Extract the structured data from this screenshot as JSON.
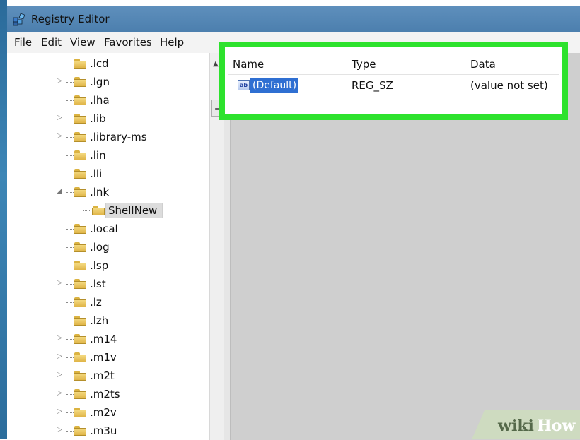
{
  "window": {
    "title": "Registry Editor"
  },
  "menu": [
    "File",
    "Edit",
    "View",
    "Favorites",
    "Help"
  ],
  "tree": {
    "items": [
      {
        "label": ".lcd",
        "expander": ""
      },
      {
        "label": ".lgn",
        "expander": "▷"
      },
      {
        "label": ".lha",
        "expander": ""
      },
      {
        "label": ".lib",
        "expander": "▷"
      },
      {
        "label": ".library-ms",
        "expander": "▷"
      },
      {
        "label": ".lin",
        "expander": ""
      },
      {
        "label": ".lli",
        "expander": ""
      },
      {
        "label": ".lnk",
        "expander": "◢"
      },
      {
        "label": "ShellNew",
        "expander": "",
        "child": true,
        "selected": true
      },
      {
        "label": ".local",
        "expander": ""
      },
      {
        "label": ".log",
        "expander": ""
      },
      {
        "label": ".lsp",
        "expander": ""
      },
      {
        "label": ".lst",
        "expander": "▷"
      },
      {
        "label": ".lz",
        "expander": ""
      },
      {
        "label": ".lzh",
        "expander": ""
      },
      {
        "label": ".m14",
        "expander": "▷"
      },
      {
        "label": ".m1v",
        "expander": "▷"
      },
      {
        "label": ".m2t",
        "expander": "▷"
      },
      {
        "label": ".m2ts",
        "expander": "▷"
      },
      {
        "label": ".m2v",
        "expander": "▷"
      },
      {
        "label": ".m3u",
        "expander": "▷"
      }
    ]
  },
  "values": {
    "columns": {
      "name": "Name",
      "type": "Type",
      "data": "Data"
    },
    "rows": [
      {
        "icon": "ab",
        "name": "(Default)",
        "type": "REG_SZ",
        "data": "(value not set)"
      }
    ]
  },
  "watermark": {
    "wiki": "wiki",
    "how": "How"
  },
  "colors": {
    "highlight": "#2de22d",
    "selection": "#2f6fd2",
    "titlebar": "#5e8fbc"
  }
}
